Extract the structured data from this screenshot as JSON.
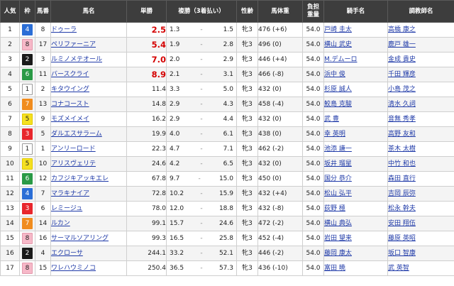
{
  "headers": {
    "rank": "人気",
    "waku": "枠",
    "umaban": "馬番",
    "horse": "馬名",
    "win": "単勝",
    "place": "複勝（3着払い）",
    "sexage": "性齢",
    "weight": "馬体重",
    "load": "負担重量",
    "jockey": "騎手名",
    "trainer": "調教師名"
  },
  "waku_colors": {
    "1": {
      "bg": "#ffffff",
      "fg": "#222222",
      "border": "#999999"
    },
    "2": {
      "bg": "#1a1a1a",
      "fg": "#ffffff",
      "border": "#1a1a1a"
    },
    "3": {
      "bg": "#e8262c",
      "fg": "#ffffff",
      "border": "#e8262c"
    },
    "4": {
      "bg": "#2b6ed6",
      "fg": "#ffffff",
      "border": "#2b6ed6"
    },
    "5": {
      "bg": "#f5e020",
      "fg": "#222222",
      "border": "#e0c800"
    },
    "6": {
      "bg": "#2a9a46",
      "fg": "#ffffff",
      "border": "#2a9a46"
    },
    "7": {
      "bg": "#f08c1e",
      "fg": "#ffffff",
      "border": "#f08c1e"
    },
    "8": {
      "bg": "#f6b8c8",
      "fg": "#222222",
      "border": "#e49aad"
    }
  },
  "rows": [
    {
      "rank": "1",
      "waku": "4",
      "umaban": "8",
      "horse": "ドゥーラ",
      "win": "2.5",
      "win_highlight": true,
      "place_lo": "1.3",
      "place_hi": "1.5",
      "sexage": "牝3",
      "weight": "476 (+6)",
      "load": "54.0",
      "jockey": "戸崎 圭太",
      "trainer": "高橋 康之"
    },
    {
      "rank": "2",
      "waku": "8",
      "umaban": "17",
      "horse": "ペリファーニア",
      "win": "5.4",
      "win_highlight": true,
      "place_lo": "1.9",
      "place_hi": "2.8",
      "sexage": "牝3",
      "weight": "496 (0)",
      "load": "54.0",
      "jockey": "横山 武史",
      "trainer": "鹿戸 雄一"
    },
    {
      "rank": "3",
      "waku": "2",
      "umaban": "3",
      "horse": "ルミノメテオール",
      "win": "7.0",
      "win_highlight": true,
      "place_lo": "2.0",
      "place_hi": "2.9",
      "sexage": "牝3",
      "weight": "446 (+4)",
      "load": "54.0",
      "jockey": "M.デムーロ",
      "trainer": "金成 貴史"
    },
    {
      "rank": "4",
      "waku": "6",
      "umaban": "11",
      "horse": "バースクライ",
      "win": "8.9",
      "win_highlight": true,
      "place_lo": "2.1",
      "place_hi": "3.1",
      "sexage": "牝3",
      "weight": "466 (-8)",
      "load": "54.0",
      "jockey": "浜中 俊",
      "trainer": "千田 輝彦"
    },
    {
      "rank": "5",
      "waku": "1",
      "umaban": "2",
      "horse": "キタウイング",
      "win": "11.4",
      "win_highlight": false,
      "place_lo": "3.3",
      "place_hi": "5.0",
      "sexage": "牝3",
      "weight": "432 (0)",
      "load": "54.0",
      "jockey": "杉原 誠人",
      "trainer": "小島 茂之"
    },
    {
      "rank": "6",
      "waku": "7",
      "umaban": "13",
      "horse": "コナコースト",
      "win": "14.8",
      "win_highlight": false,
      "place_lo": "2.9",
      "place_hi": "4.3",
      "sexage": "牝3",
      "weight": "458 (-4)",
      "load": "54.0",
      "jockey": "鮫島 克駿",
      "trainer": "清水 久詞"
    },
    {
      "rank": "7",
      "waku": "5",
      "umaban": "9",
      "horse": "モズメイメイ",
      "win": "16.2",
      "win_highlight": false,
      "place_lo": "2.9",
      "place_hi": "4.4",
      "sexage": "牝3",
      "weight": "432 (0)",
      "load": "54.0",
      "jockey": "武 豊",
      "trainer": "音無 秀孝"
    },
    {
      "rank": "8",
      "waku": "3",
      "umaban": "5",
      "horse": "ダルエスサラーム",
      "win": "19.9",
      "win_highlight": false,
      "place_lo": "4.0",
      "place_hi": "6.1",
      "sexage": "牝3",
      "weight": "438 (0)",
      "load": "54.0",
      "jockey": "幸 英明",
      "trainer": "高野 友和"
    },
    {
      "rank": "9",
      "waku": "1",
      "umaban": "1",
      "horse": "アンリーロード",
      "win": "22.3",
      "win_highlight": false,
      "place_lo": "4.7",
      "place_hi": "7.1",
      "sexage": "牝3",
      "weight": "462 (-2)",
      "load": "54.0",
      "jockey": "池添 謙一",
      "trainer": "茶木 太樹"
    },
    {
      "rank": "10",
      "waku": "5",
      "umaban": "10",
      "horse": "アリスヴェリテ",
      "win": "24.6",
      "win_highlight": false,
      "place_lo": "4.2",
      "place_hi": "6.5",
      "sexage": "牝3",
      "weight": "432 (0)",
      "load": "54.0",
      "jockey": "坂井 瑠星",
      "trainer": "中竹 和也"
    },
    {
      "rank": "11",
      "waku": "6",
      "umaban": "12",
      "horse": "カフジキアッキエレ",
      "win": "67.8",
      "win_highlight": false,
      "place_lo": "9.7",
      "place_hi": "15.0",
      "sexage": "牝3",
      "weight": "450 (0)",
      "load": "54.0",
      "jockey": "国分 恭介",
      "trainer": "森田 直行"
    },
    {
      "rank": "12",
      "waku": "4",
      "umaban": "7",
      "horse": "マラキナイア",
      "win": "72.8",
      "win_highlight": false,
      "place_lo": "10.2",
      "place_hi": "15.9",
      "sexage": "牝3",
      "weight": "432 (+4)",
      "load": "54.0",
      "jockey": "松山 弘平",
      "trainer": "吉岡 辰弥"
    },
    {
      "rank": "13",
      "waku": "3",
      "umaban": "6",
      "horse": "レミージュ",
      "win": "78.0",
      "win_highlight": false,
      "place_lo": "12.0",
      "place_hi": "18.8",
      "sexage": "牝3",
      "weight": "432 (-8)",
      "load": "54.0",
      "jockey": "荻野 極",
      "trainer": "松永 幹夫"
    },
    {
      "rank": "14",
      "waku": "7",
      "umaban": "14",
      "horse": "ルカン",
      "win": "99.1",
      "win_highlight": false,
      "place_lo": "15.7",
      "place_hi": "24.6",
      "sexage": "牝3",
      "weight": "472 (-2)",
      "load": "54.0",
      "jockey": "横山 典弘",
      "trainer": "安田 翔伍"
    },
    {
      "rank": "15",
      "waku": "8",
      "umaban": "16",
      "horse": "サーマルソアリング",
      "win": "99.3",
      "win_highlight": false,
      "place_lo": "16.5",
      "place_hi": "25.8",
      "sexage": "牝3",
      "weight": "452 (-4)",
      "load": "54.0",
      "jockey": "岩田 望来",
      "trainer": "藤原 英昭"
    },
    {
      "rank": "16",
      "waku": "2",
      "umaban": "4",
      "horse": "エクローサ",
      "win": "244.1",
      "win_highlight": false,
      "place_lo": "33.2",
      "place_hi": "52.1",
      "sexage": "牝3",
      "weight": "446 (-2)",
      "load": "54.0",
      "jockey": "藤岡 康太",
      "trainer": "坂口 智康"
    },
    {
      "rank": "17",
      "waku": "8",
      "umaban": "15",
      "horse": "ワレハウミノコ",
      "win": "250.4",
      "win_highlight": false,
      "place_lo": "36.5",
      "place_hi": "57.3",
      "sexage": "牝3",
      "weight": "436 (-10)",
      "load": "54.0",
      "jockey": "富田 暁",
      "trainer": "武 英智"
    }
  ]
}
